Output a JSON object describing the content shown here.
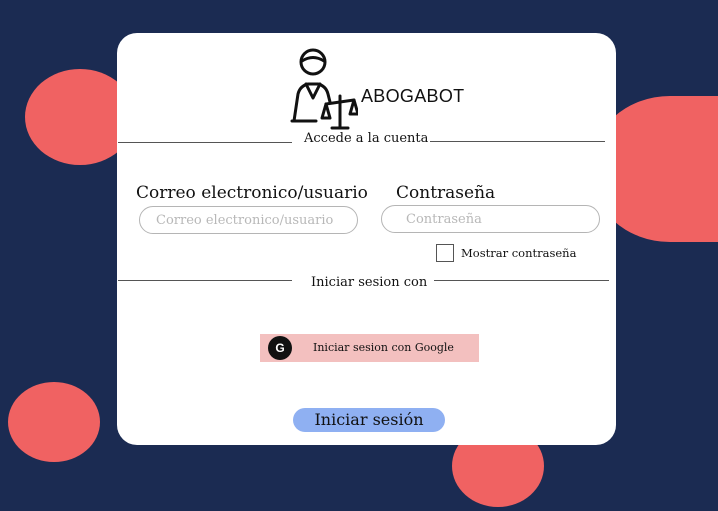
{
  "brand": {
    "name": "ABOGABOT",
    "icon": "lawyer-scales-icon"
  },
  "login": {
    "heading": "Accede a la cuenta",
    "email_label": "Correo electronico/usuario",
    "email_placeholder": "Correo electronico/usuario",
    "email_value": "",
    "password_label": "Contraseña",
    "password_placeholder": "Contraseña",
    "password_value": "",
    "show_password_label": "Mostrar contraseña",
    "show_password_checked": false,
    "alt_signin_heading": "Iniciar sesion con",
    "google_button_label": "Iniciar sesion con Google",
    "google_icon_letter": "G",
    "submit_label": "Iniciar sesión"
  },
  "colors": {
    "background": "#1b2b52",
    "accent_blob": "#f06262",
    "google_button": "#f3c0bf",
    "submit_button": "#8fb0f2"
  }
}
